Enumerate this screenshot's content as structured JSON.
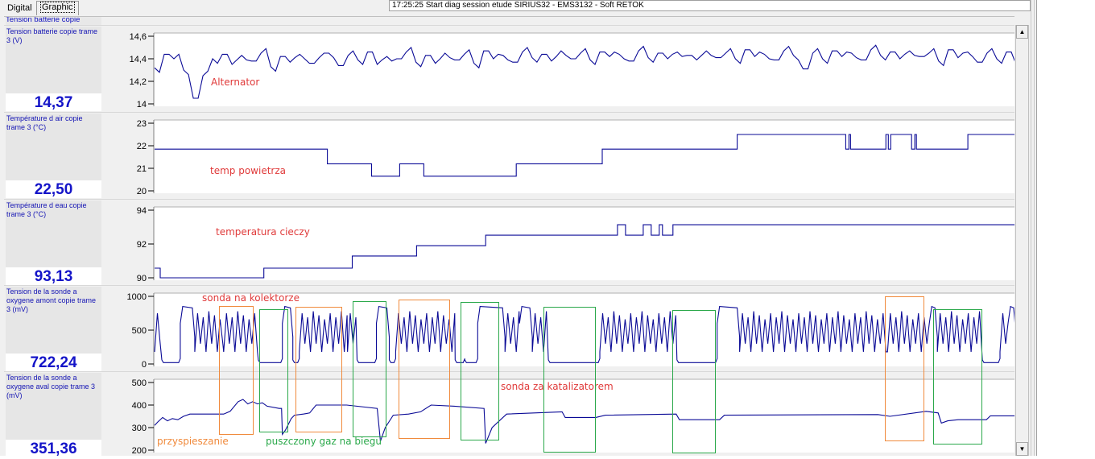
{
  "tabs": [
    {
      "label": "Digital",
      "selected": false
    },
    {
      "label": "Graphic",
      "selected": true
    }
  ],
  "log_text": "17:25:25 Start diag session etude SIRIUS32 - EMS3132 - Soft RETOK",
  "header_row_label": "Tension batterie copie trame",
  "panels": [
    {
      "label": "Tension batterie copie trame 3 (V)",
      "value": "14,37"
    },
    {
      "label": "Température d air copie trame 3 (°C)",
      "value": "22,50"
    },
    {
      "label": "Température d eau copie trame 3 (°C)",
      "value": "93,13"
    },
    {
      "label": "Tension de la sonde a oxygene amont copie trame 3 (mV)",
      "value": "722,24"
    },
    {
      "label": "Tension de la sonde a oxygene aval copie trame 3 (mV)",
      "value": "351,36"
    }
  ],
  "annotations": {
    "alternator": "Alternator",
    "air": "temp powietrza",
    "coolant": "temperatura cieczy",
    "upstream": "sonda na kolektorze",
    "downstream": "sonda za katalizatorem",
    "accel": "przyspieszanie",
    "coast": "puszczony gaz na biegu",
    "colors": {
      "red": "#e03a3a",
      "orange": "#f08a3c",
      "green": "#2aa84a"
    }
  },
  "line_color": "#0a0a96",
  "chart_data": [
    {
      "type": "line",
      "name": "battery",
      "ylim": [
        14,
        14.6
      ],
      "yticks": [
        "14",
        "14,2",
        "14,4",
        "14,6"
      ],
      "ytick_values": [
        14,
        14.2,
        14.4,
        14.6
      ],
      "xlim": [
        0,
        1072
      ],
      "values": [
        14.32,
        14.44,
        14.4,
        14.3,
        14.05,
        14.25,
        14.4,
        14.44,
        14.35,
        14.43,
        14.38,
        14.45,
        14.33,
        14.42,
        14.37,
        14.44,
        14.36,
        14.41,
        14.45,
        14.34,
        14.43,
        14.39,
        14.46,
        14.35,
        14.42,
        14.4,
        14.46,
        14.37,
        14.43,
        14.36,
        14.45,
        14.39,
        14.44,
        14.36,
        14.47,
        14.4,
        14.43,
        14.37,
        14.46,
        14.41,
        14.44,
        14.38,
        14.47,
        14.4,
        14.45,
        14.39,
        14.46,
        14.42,
        14.44,
        14.38,
        14.47,
        14.41,
        14.45,
        14.4,
        14.46,
        14.43,
        14.39,
        14.47,
        14.41,
        14.45,
        14.4,
        14.48,
        14.42,
        14.44,
        14.39,
        14.47,
        14.43,
        14.31,
        14.45,
        14.4,
        14.47,
        14.42,
        14.45,
        14.39,
        14.48,
        14.43,
        14.46,
        14.4,
        14.47,
        14.42,
        14.45,
        14.38,
        14.48,
        14.41,
        14.46,
        14.37,
        14.45,
        14.4,
        14.46,
        14.35
      ]
    },
    {
      "type": "line",
      "name": "air-temp",
      "ylim": [
        20,
        23
      ],
      "yticks": [
        "20",
        "21",
        "22",
        "23"
      ],
      "ytick_values": [
        20,
        21,
        22,
        23
      ],
      "xlim": [
        0,
        1072
      ],
      "steps": [
        [
          0,
          21.85
        ],
        [
          215,
          21.2
        ],
        [
          270,
          20.65
        ],
        [
          305,
          21.2
        ],
        [
          335,
          20.65
        ],
        [
          450,
          21.2
        ],
        [
          557,
          21.85
        ],
        [
          725,
          22.5
        ],
        [
          860,
          21.85
        ],
        [
          864,
          22.5
        ],
        [
          866,
          21.85
        ],
        [
          910,
          22.5
        ],
        [
          913,
          21.85
        ],
        [
          916,
          22.5
        ],
        [
          942,
          21.85
        ],
        [
          946,
          22.5
        ],
        [
          948,
          21.85
        ],
        [
          1012,
          22.5
        ],
        [
          1072,
          22.5
        ]
      ]
    },
    {
      "type": "line",
      "name": "coolant-temp",
      "ylim": [
        90,
        94
      ],
      "yticks": [
        "90",
        "92",
        "94"
      ],
      "ytick_values": [
        90,
        92,
        94
      ],
      "xlim": [
        0,
        1072
      ],
      "steps": [
        [
          0,
          90.57
        ],
        [
          7,
          90
        ],
        [
          136,
          90.57
        ],
        [
          246,
          91.29
        ],
        [
          326,
          91.9
        ],
        [
          412,
          92.52
        ],
        [
          576,
          93.14
        ],
        [
          586,
          92.52
        ],
        [
          608,
          93.14
        ],
        [
          618,
          92.52
        ],
        [
          628,
          93.14
        ],
        [
          632,
          92.52
        ],
        [
          645,
          93.14
        ],
        [
          1072,
          93.14
        ]
      ]
    },
    {
      "type": "line",
      "name": "o2-upstream",
      "ylim": [
        0,
        1000
      ],
      "yticks": [
        "0",
        "500",
        "1000"
      ],
      "ytick_values": [
        0,
        500,
        1000
      ],
      "xlim": [
        0,
        1072
      ],
      "segments": [
        [
          0,
          9,
          "osc"
        ],
        [
          9,
          32,
          "lean"
        ],
        [
          32,
          50,
          "rich"
        ],
        [
          50,
          86,
          "osc"
        ],
        [
          86,
          129,
          "osc"
        ],
        [
          129,
          159,
          "lean"
        ],
        [
          159,
          172,
          "rich"
        ],
        [
          172,
          180,
          "lean"
        ],
        [
          180,
          240,
          "osc"
        ],
        [
          240,
          252,
          "osc"
        ],
        [
          252,
          276,
          "lean"
        ],
        [
          276,
          292,
          "rich"
        ],
        [
          292,
          300,
          "lean"
        ],
        [
          300,
          374,
          "osc"
        ],
        [
          374,
          386,
          "lean"
        ],
        [
          386,
          402,
          "lean"
        ],
        [
          402,
          436,
          "rich"
        ],
        [
          436,
          454,
          "osc"
        ],
        [
          454,
          470,
          "rich"
        ],
        [
          470,
          490,
          "osc"
        ],
        [
          490,
          554,
          "lean"
        ],
        [
          554,
          650,
          "osc"
        ],
        [
          650,
          700,
          "lean"
        ],
        [
          700,
          728,
          "rich"
        ],
        [
          728,
          912,
          "osc"
        ],
        [
          912,
          964,
          "osc"
        ],
        [
          964,
          974,
          "rich"
        ],
        [
          974,
          1030,
          "osc"
        ],
        [
          1030,
          1052,
          "lean"
        ],
        [
          1052,
          1062,
          "osc"
        ],
        [
          1062,
          1072,
          "rich"
        ]
      ]
    },
    {
      "type": "line",
      "name": "o2-downstream",
      "ylim": [
        200,
        500
      ],
      "yticks": [
        "200",
        "300",
        "400",
        "500"
      ],
      "ytick_values": [
        200,
        300,
        400,
        500
      ],
      "xlim": [
        0,
        1072
      ],
      "points": [
        [
          0,
          310
        ],
        [
          4,
          325
        ],
        [
          10,
          345
        ],
        [
          16,
          330
        ],
        [
          22,
          340
        ],
        [
          29,
          335
        ],
        [
          36,
          350
        ],
        [
          44,
          360
        ],
        [
          86,
          360
        ],
        [
          94,
          372
        ],
        [
          104,
          415
        ],
        [
          110,
          425
        ],
        [
          116,
          405
        ],
        [
          122,
          415
        ],
        [
          128,
          405
        ],
        [
          134,
          410
        ],
        [
          140,
          395
        ],
        [
          155,
          385
        ],
        [
          158,
          385
        ],
        [
          159,
          270
        ],
        [
          163,
          290
        ],
        [
          170,
          340
        ],
        [
          174,
          355
        ],
        [
          185,
          360
        ],
        [
          193,
          365
        ],
        [
          201,
          400
        ],
        [
          239,
          400
        ],
        [
          277,
          385
        ],
        [
          281,
          240
        ],
        [
          287,
          300
        ],
        [
          297,
          355
        ],
        [
          316,
          360
        ],
        [
          331,
          370
        ],
        [
          344,
          400
        ],
        [
          373,
          395
        ],
        [
          410,
          385
        ],
        [
          412,
          230
        ],
        [
          420,
          300
        ],
        [
          438,
          360
        ],
        [
          507,
          370
        ],
        [
          511,
          345
        ],
        [
          549,
          345
        ],
        [
          561,
          355
        ],
        [
          649,
          360
        ],
        [
          653,
          335
        ],
        [
          703,
          335
        ],
        [
          709,
          355
        ],
        [
          900,
          358
        ],
        [
          915,
          350
        ],
        [
          960,
          372
        ],
        [
          975,
          365
        ],
        [
          979,
          320
        ],
        [
          987,
          330
        ],
        [
          1000,
          335
        ],
        [
          1035,
          335
        ],
        [
          1040,
          352
        ],
        [
          1072,
          352
        ]
      ]
    }
  ]
}
